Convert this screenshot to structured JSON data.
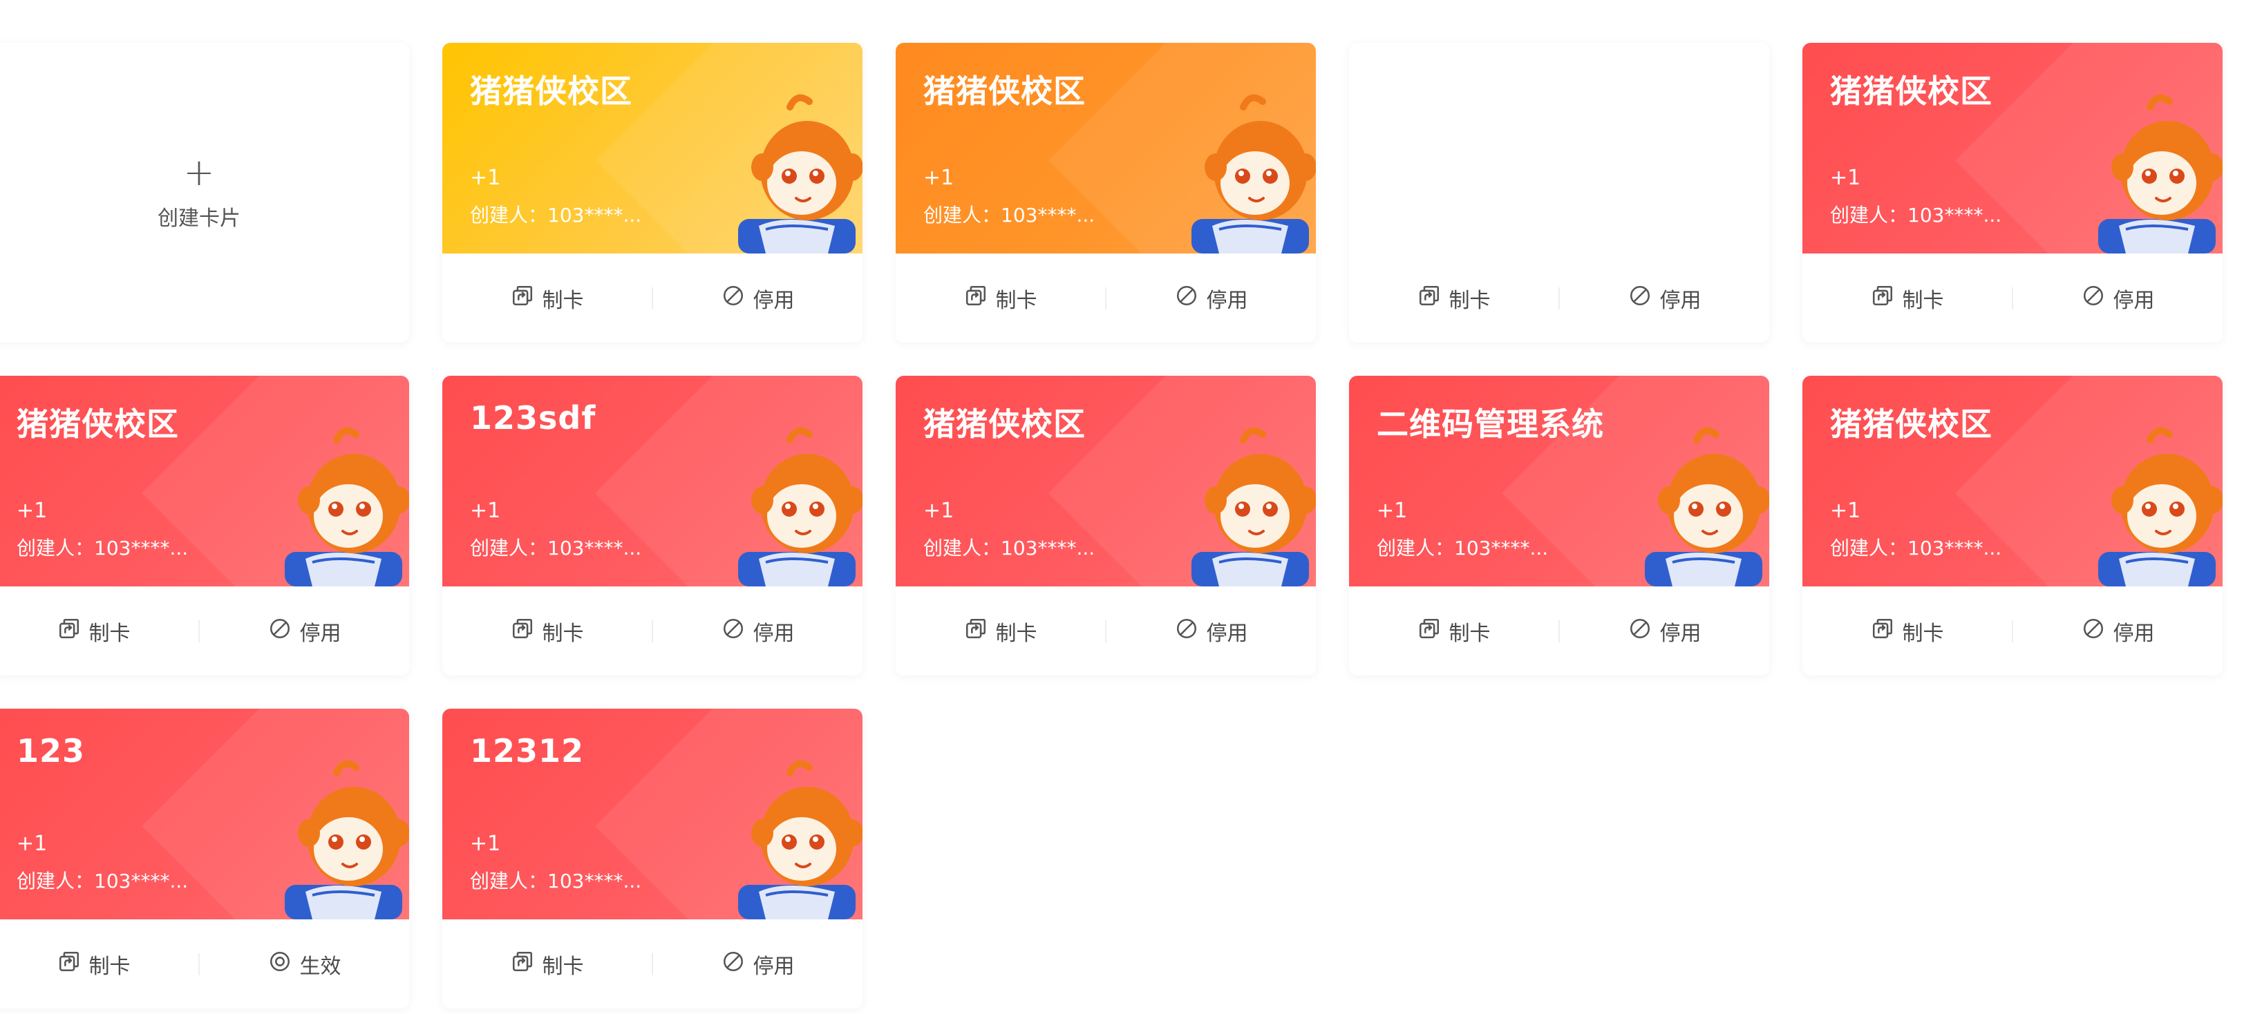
{
  "create_card": {
    "plus": "+",
    "label": "创建卡片"
  },
  "actions": {
    "make_card": "制卡",
    "disable": "停用",
    "enable": "生效"
  },
  "cards": [
    {
      "title": "猪猪侠校区",
      "count": "+1",
      "creator": "创建人：103****...",
      "theme": "yellow",
      "status_action": "停用"
    },
    {
      "title": "猪猪侠校区",
      "count": "+1",
      "creator": "创建人：103****...",
      "theme": "orange",
      "status_action": "停用"
    },
    {
      "title": "",
      "count": "",
      "creator": "",
      "theme": "blank",
      "status_action": "停用"
    },
    {
      "title": "猪猪侠校区",
      "count": "+1",
      "creator": "创建人：103****...",
      "theme": "red",
      "status_action": "停用"
    },
    {
      "title": "猪猪侠校区",
      "count": "+1",
      "creator": "创建人：103****...",
      "theme": "red",
      "status_action": "停用"
    },
    {
      "title": "123sdf",
      "count": "+1",
      "creator": "创建人：103****...",
      "theme": "red",
      "status_action": "停用"
    },
    {
      "title": "猪猪侠校区",
      "count": "+1",
      "creator": "创建人：103****...",
      "theme": "red",
      "status_action": "停用"
    },
    {
      "title": "二维码管理系统",
      "count": "+1",
      "creator": "创建人：103****...",
      "theme": "red",
      "status_action": "停用"
    },
    {
      "title": "猪猪侠校区",
      "count": "+1",
      "creator": "创建人：103****...",
      "theme": "red",
      "status_action": "停用"
    },
    {
      "title": "123",
      "count": "+1",
      "creator": "创建人：103****...",
      "theme": "red",
      "status_action": "生效"
    },
    {
      "title": "12312",
      "count": "+1",
      "creator": "创建人：103****...",
      "theme": "red",
      "status_action": "停用"
    }
  ],
  "icons": {
    "make_card": "copy-arrow-icon",
    "disable": "ban-icon",
    "enable": "target-icon"
  },
  "colors": {
    "red": "#ff4d4f",
    "yellow": "#ffc400",
    "orange": "#ff8a1f"
  }
}
